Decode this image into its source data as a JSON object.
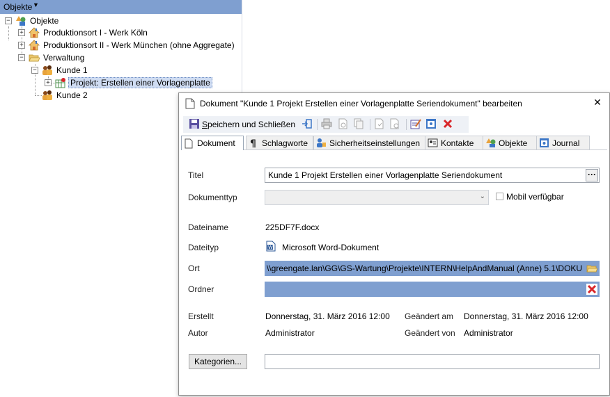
{
  "tree": {
    "header_label": "Objekte",
    "nodes": [
      {
        "label": "Objekte"
      },
      {
        "label": "Produktionsort I - Werk Köln"
      },
      {
        "label": "Produktionsort II - Werk München (ohne Aggregate)"
      },
      {
        "label": "Verwaltung"
      },
      {
        "label": "Kunde 1"
      },
      {
        "label": "Projekt: Erstellen einer Vorlagenplatte"
      },
      {
        "label": "Kunde 2"
      }
    ]
  },
  "dialog": {
    "title": "Dokument \"Kunde 1 Projekt  Erstellen einer Vorlagenplatte Seriendokument\" bearbeiten",
    "toolbar": {
      "save_label_prefix": "S",
      "save_label_rest": "peichern und Schließen"
    },
    "tabs": [
      {
        "label": "Dokument"
      },
      {
        "label": "Schlagworte"
      },
      {
        "label": "Sicherheitseinstellungen"
      },
      {
        "label": "Kontakte"
      },
      {
        "label": "Objekte"
      },
      {
        "label": "Journal"
      }
    ],
    "form": {
      "titel_label": "Titel",
      "titel_value": "Kunde 1 Projekt  Erstellen einer Vorlagenplatte Seriendokument",
      "ellipsis": "···",
      "dokumenttyp_label": "Dokumenttyp",
      "dokumenttyp_value": "",
      "mobil_label": "Mobil verfügbar",
      "mobil_checked": false,
      "dateiname_label": "Dateiname",
      "dateiname_value": "225DF7F.docx",
      "dateityp_label": "Dateityp",
      "dateityp_value": "Microsoft Word-Dokument",
      "ort_label": "Ort",
      "ort_value": "\\\\greengate.lan\\GG\\GS-Wartung\\Projekte\\INTERN\\HelpAndManual (Anne) 5.1\\DOKU",
      "ordner_label": "Ordner",
      "ordner_value": "",
      "erstellt_label": "Erstellt",
      "erstellt_value": "Donnerstag, 31. März 2016 12:00",
      "geaendert_am_label": "Geändert am",
      "geaendert_am_value": "Donnerstag, 31. März 2016 12:00",
      "autor_label": "Autor",
      "autor_value": "Administrator",
      "geaendert_von_label": "Geändert von",
      "geaendert_von_value": "Administrator",
      "kategorien_label": "Kategorien...",
      "kategorien_value": ""
    }
  },
  "colors": {
    "selection_blue": "#7f9fd0",
    "delete_red": "#d9262a"
  }
}
